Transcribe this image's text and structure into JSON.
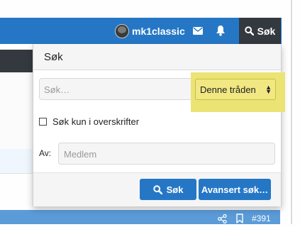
{
  "nav": {
    "username": "mk1classic",
    "search_label": "Søk"
  },
  "search_menu": {
    "title": "Søk",
    "query_placeholder": "Søk…",
    "scope_selected": "Denne tråden",
    "titles_only_label": "Søk kun i overskrifter",
    "titles_only_checked": false,
    "by_label": "Av:",
    "member_placeholder": "Medlem",
    "search_button": "Søk",
    "advanced_button": "Avansert søk…"
  },
  "post": {
    "number": "#391"
  },
  "colors": {
    "nav_blue": "#2577c6",
    "dark_bar": "#33393f",
    "highlight_yellow": "#ece375",
    "button_blue": "#2577c6"
  }
}
